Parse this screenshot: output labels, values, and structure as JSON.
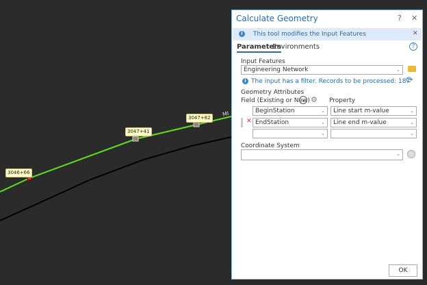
{
  "map": {
    "station_labels": [
      "3046+66",
      "3047+41",
      "3047+82"
    ],
    "road_label": "MI",
    "line_color": "#5ee01a"
  },
  "dialog": {
    "title": "Calculate Geometry",
    "help": "?",
    "close": "✕",
    "info_banner": "This tool modifies the Input Features",
    "tabs": [
      {
        "label": "Parameters",
        "active": true
      },
      {
        "label": "Environments",
        "active": false
      }
    ],
    "input_features": {
      "label": "Input Features",
      "value": "Engineering Network"
    },
    "filter_message": "The input has a filter. Records to be processed: 187",
    "geometry_attributes": {
      "label": "Geometry Attributes",
      "field_header": "Field (Existing or New)",
      "property_header": "Property",
      "rows": [
        {
          "field": "BeginStation",
          "property": "Line start m-value"
        },
        {
          "field": "EndStation",
          "property": "Line end m-value"
        },
        {
          "field": "",
          "property": ""
        }
      ]
    },
    "coordinate_system": {
      "label": "Coordinate System",
      "value": ""
    },
    "ok_label": "OK"
  }
}
